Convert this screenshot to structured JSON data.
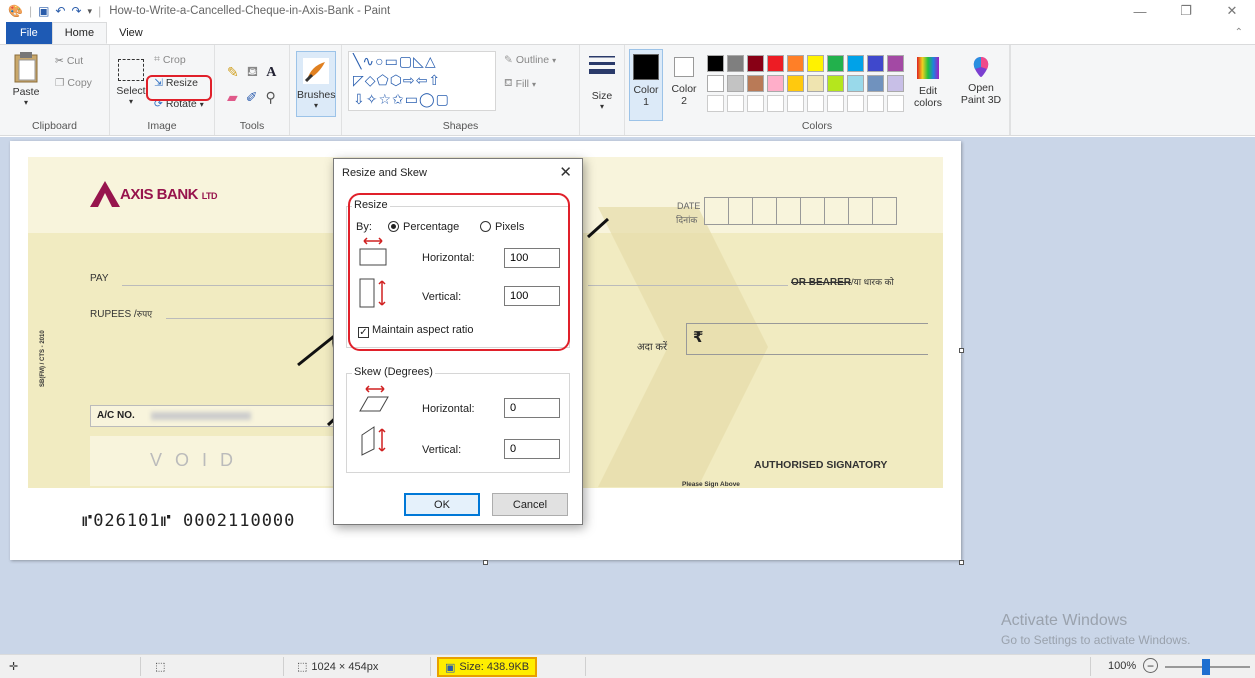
{
  "window": {
    "title": "How-to-Write-a-Cancelled-Cheque-in-Axis-Bank - Paint",
    "minimize": "—",
    "maximize": "❐",
    "close": "✕"
  },
  "tabs": {
    "file": "File",
    "home": "Home",
    "view": "View"
  },
  "ribbon": {
    "clipboard": {
      "label": "Clipboard",
      "paste": "Paste",
      "cut": "Cut",
      "copy": "Copy"
    },
    "image": {
      "label": "Image",
      "select": "Select",
      "crop": "Crop",
      "resize": "Resize",
      "rotate": "Rotate"
    },
    "tools": {
      "label": "Tools",
      "text_tool": "A"
    },
    "brushes": {
      "label": "Brushes"
    },
    "shapes": {
      "label": "Shapes",
      "outline": "Outline",
      "fill": "Fill"
    },
    "size": {
      "label": "Size"
    },
    "colors": {
      "label": "Colors",
      "color1": "Color",
      "color1_num": "1",
      "color2": "Color",
      "color2_num": "2",
      "edit": "Edit",
      "edit2": "colors",
      "palette_row1": [
        "#000000",
        "#7f7f7f",
        "#880015",
        "#ed1c24",
        "#ff7f27",
        "#fff200",
        "#22b14c",
        "#00a2e8",
        "#3f48cc",
        "#a349a4"
      ],
      "palette_row2": [
        "#ffffff",
        "#c3c3c3",
        "#b97a57",
        "#ffaec9",
        "#ffc90e",
        "#efe4b0",
        "#b5e61d",
        "#99d9ea",
        "#7092be",
        "#c8bfe7"
      ]
    },
    "paint3d": {
      "line1": "Open",
      "line2": "Paint 3D"
    }
  },
  "cheque": {
    "bank": "AXIS BANK",
    "ltd": "LTD",
    "date_en": "DATE",
    "date_hi": "दिनांक",
    "pay": "PAY",
    "bearer": "OR BEARER",
    "bearer_hi": "/या धारक को",
    "rupees": "RUPEES /",
    "rupees_hi": "रुपए",
    "ada_kare": "अदा करें",
    "rupee_symbol": "₹",
    "side_code": "SB(FM) / CTS - 2010",
    "acno": "A/C NO.",
    "void": "V  O  I  D",
    "authorised": "AUTHORISED SIGNATORY",
    "sign_above": "Please Sign Above",
    "micr": "⑈026101⑈  0002110000"
  },
  "dialog": {
    "title": "Resize and Skew",
    "close": "✕",
    "resize_legend": "Resize",
    "by": "By:",
    "percentage": "Percentage",
    "pixels": "Pixels",
    "horizontal": "Horizontal:",
    "vertical": "Vertical:",
    "resize_h_value": "100",
    "resize_v_value": "100",
    "maintain": "Maintain aspect ratio",
    "skew_legend": "Skew (Degrees)",
    "skew_h_value": "0",
    "skew_v_value": "0",
    "ok": "OK",
    "cancel": "Cancel"
  },
  "status": {
    "dimensions": "1024 × 454px",
    "size": "Size: 438.9KB",
    "zoom": "100%"
  },
  "watermark": {
    "line1": "Activate Windows",
    "line2": "Go to Settings to activate Windows."
  }
}
